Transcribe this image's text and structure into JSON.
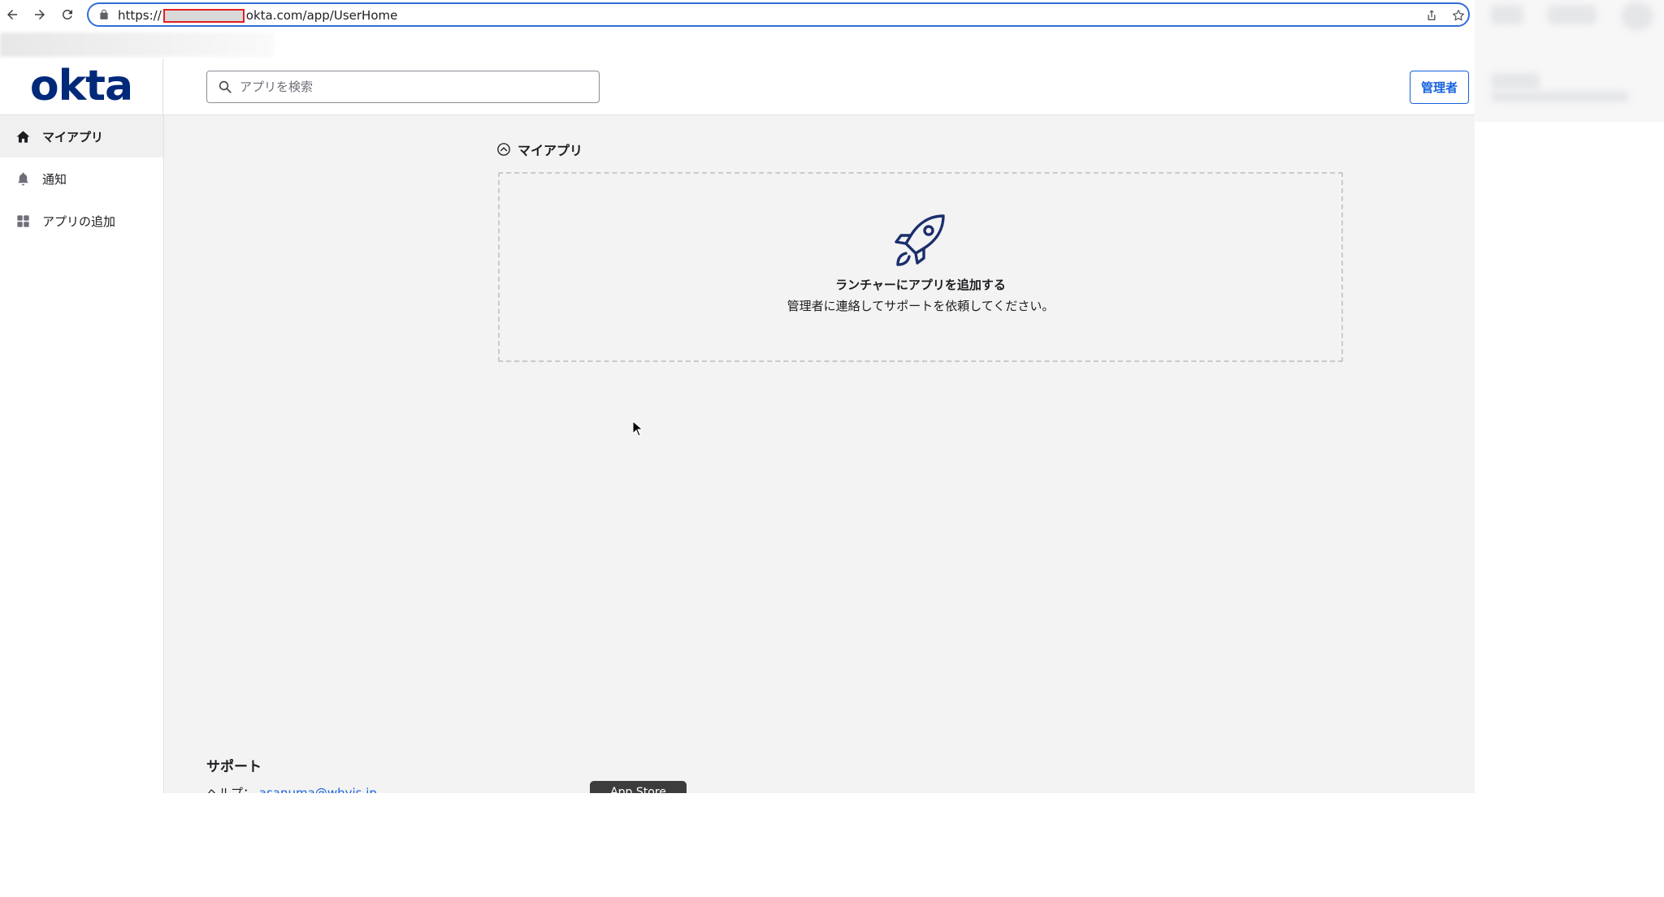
{
  "browser": {
    "url_prefix": "https://",
    "url_suffix": "okta.com/app/UserHome"
  },
  "header": {
    "logo_text": "okta",
    "search": {
      "placeholder": "アプリを検索",
      "value": ""
    },
    "admin_label": "管理者"
  },
  "sidebar": {
    "items": [
      {
        "label": "マイアプリ",
        "icon": "home-icon",
        "active": true
      },
      {
        "label": "通知",
        "icon": "bell-icon",
        "active": false
      },
      {
        "label": "アプリの追加",
        "icon": "grid-icon",
        "active": false
      }
    ]
  },
  "main": {
    "section_title": "マイアプリ",
    "empty_state": {
      "icon": "rocket-icon",
      "title": "ランチャーにアプリを追加する",
      "subtitle": "管理者に連絡してサポートを依頼してください。"
    }
  },
  "footer": {
    "support_title": "サポート",
    "help_label": "ヘルプ：",
    "help_email": "asanuma@whyis.jp",
    "app_store_label": "App Store"
  },
  "colors": {
    "brand_blue": "#1662dd",
    "okta_navy": "#00297a",
    "content_bg": "#f3f3f3"
  }
}
